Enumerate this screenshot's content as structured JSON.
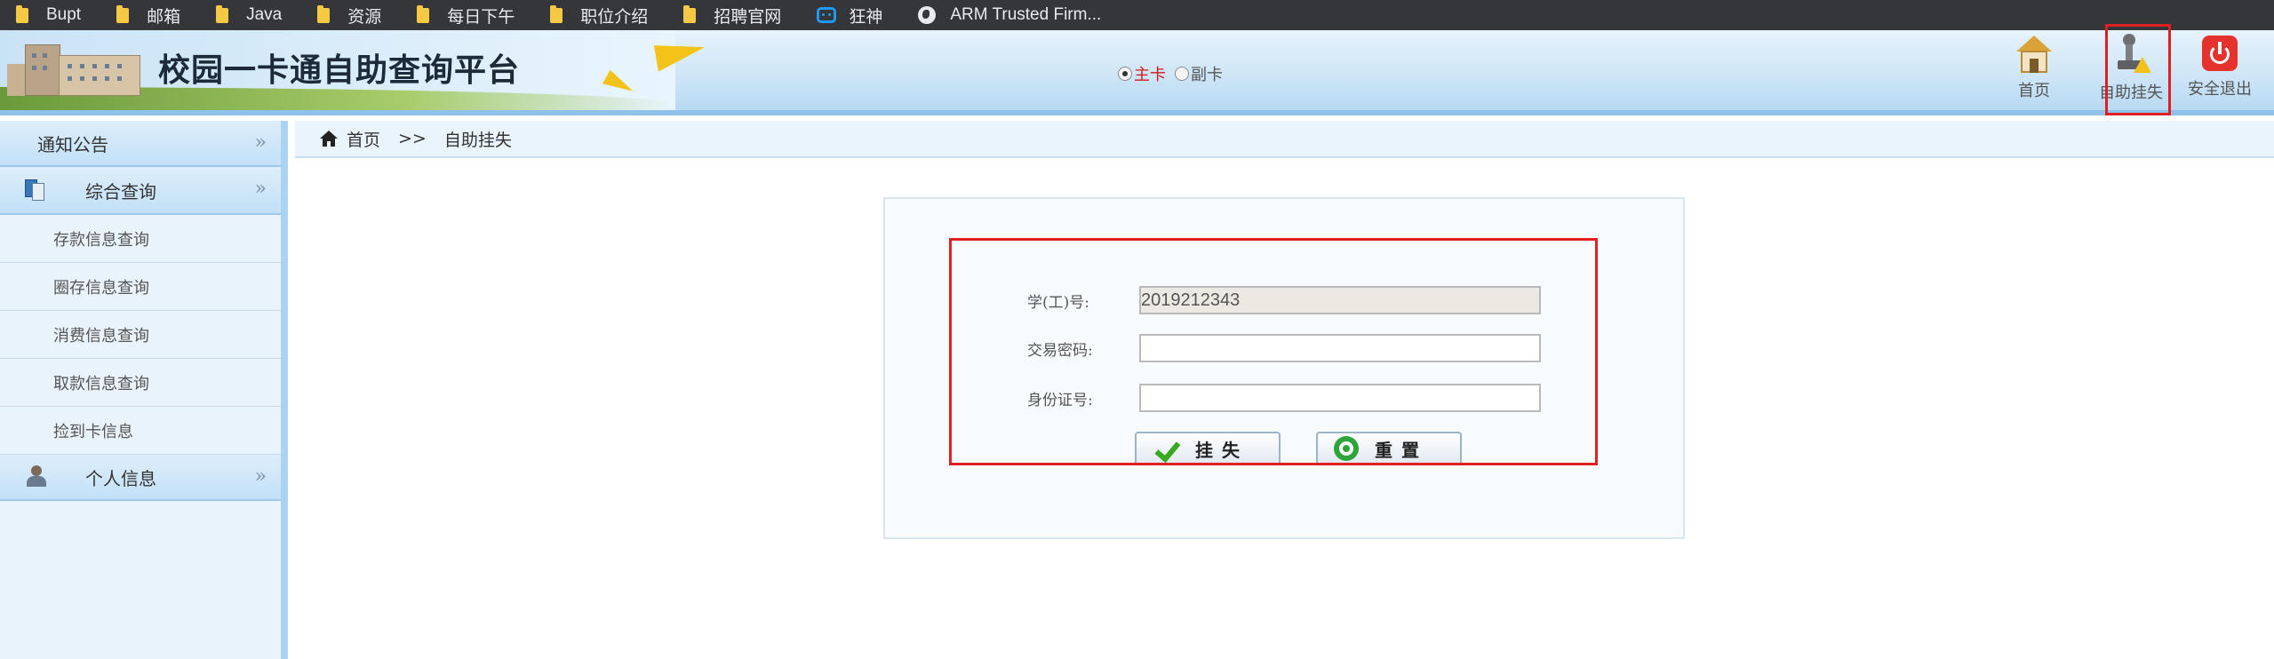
{
  "bookmarks": [
    {
      "label": "Bupt",
      "icon": "folder-icon"
    },
    {
      "label": "邮箱",
      "icon": "folder-icon"
    },
    {
      "label": "Java",
      "icon": "folder-icon"
    },
    {
      "label": "资源",
      "icon": "folder-icon"
    },
    {
      "label": "每日下午",
      "icon": "folder-icon"
    },
    {
      "label": "职位介绍",
      "icon": "folder-icon"
    },
    {
      "label": "招聘官网",
      "icon": "folder-icon"
    },
    {
      "label": "狂神",
      "icon": "bilibili-icon"
    },
    {
      "label": "ARM Trusted Firm...",
      "icon": "globe-icon"
    }
  ],
  "header": {
    "title": "校园一卡通自助查询平台",
    "card_options": {
      "main": "主卡",
      "sub": "副卡",
      "selected": "main"
    },
    "nav": {
      "home": "首页",
      "self_lost": "自助挂失",
      "logout": "安全退出"
    }
  },
  "sidebar": {
    "notice": "通知公告",
    "query": "综合查询",
    "query_items": [
      "存款信息查询",
      "圈存信息查询",
      "消费信息查询",
      "取款信息查询",
      "捡到卡信息"
    ],
    "personal": "个人信息",
    "chevron": "»"
  },
  "breadcrumb": {
    "home": "首页",
    "sep": ">>",
    "current": "自助挂失"
  },
  "form": {
    "student_id_label": "学(工)号:",
    "student_id_value": "2019212343",
    "password_label": "交易密码:",
    "password_value": "",
    "id_card_label": "身份证号:",
    "id_card_value": "",
    "submit_label": "挂失",
    "reset_label": "重置"
  },
  "colors": {
    "accent_red": "#e02020",
    "header_blue": "#cfe6f7",
    "sidebar_bg": "#e8f3fc"
  }
}
